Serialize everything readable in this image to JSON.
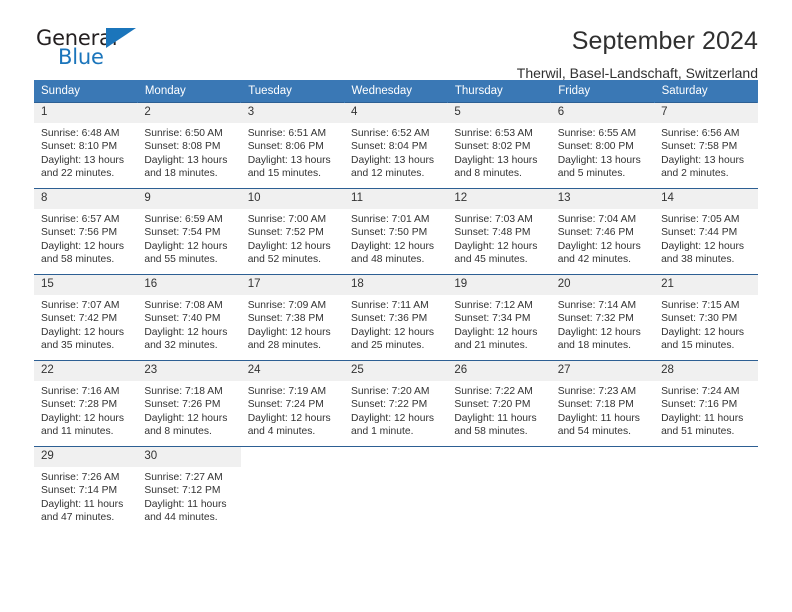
{
  "brand": {
    "name_top": "General",
    "name_bottom": "Blue",
    "triangle_color": "#1b75bb"
  },
  "header": {
    "title": "September 2024",
    "subtitle": "Therwil, Basel-Landschaft, Switzerland",
    "accent_color": "#3a78b5"
  },
  "calendar": {
    "weekday_headers": [
      "Sunday",
      "Monday",
      "Tuesday",
      "Wednesday",
      "Thursday",
      "Friday",
      "Saturday"
    ],
    "weeks": [
      [
        {
          "day": "1",
          "sunrise": "Sunrise: 6:48 AM",
          "sunset": "Sunset: 8:10 PM",
          "daylight": "Daylight: 13 hours and 22 minutes."
        },
        {
          "day": "2",
          "sunrise": "Sunrise: 6:50 AM",
          "sunset": "Sunset: 8:08 PM",
          "daylight": "Daylight: 13 hours and 18 minutes."
        },
        {
          "day": "3",
          "sunrise": "Sunrise: 6:51 AM",
          "sunset": "Sunset: 8:06 PM",
          "daylight": "Daylight: 13 hours and 15 minutes."
        },
        {
          "day": "4",
          "sunrise": "Sunrise: 6:52 AM",
          "sunset": "Sunset: 8:04 PM",
          "daylight": "Daylight: 13 hours and 12 minutes."
        },
        {
          "day": "5",
          "sunrise": "Sunrise: 6:53 AM",
          "sunset": "Sunset: 8:02 PM",
          "daylight": "Daylight: 13 hours and 8 minutes."
        },
        {
          "day": "6",
          "sunrise": "Sunrise: 6:55 AM",
          "sunset": "Sunset: 8:00 PM",
          "daylight": "Daylight: 13 hours and 5 minutes."
        },
        {
          "day": "7",
          "sunrise": "Sunrise: 6:56 AM",
          "sunset": "Sunset: 7:58 PM",
          "daylight": "Daylight: 13 hours and 2 minutes."
        }
      ],
      [
        {
          "day": "8",
          "sunrise": "Sunrise: 6:57 AM",
          "sunset": "Sunset: 7:56 PM",
          "daylight": "Daylight: 12 hours and 58 minutes."
        },
        {
          "day": "9",
          "sunrise": "Sunrise: 6:59 AM",
          "sunset": "Sunset: 7:54 PM",
          "daylight": "Daylight: 12 hours and 55 minutes."
        },
        {
          "day": "10",
          "sunrise": "Sunrise: 7:00 AM",
          "sunset": "Sunset: 7:52 PM",
          "daylight": "Daylight: 12 hours and 52 minutes."
        },
        {
          "day": "11",
          "sunrise": "Sunrise: 7:01 AM",
          "sunset": "Sunset: 7:50 PM",
          "daylight": "Daylight: 12 hours and 48 minutes."
        },
        {
          "day": "12",
          "sunrise": "Sunrise: 7:03 AM",
          "sunset": "Sunset: 7:48 PM",
          "daylight": "Daylight: 12 hours and 45 minutes."
        },
        {
          "day": "13",
          "sunrise": "Sunrise: 7:04 AM",
          "sunset": "Sunset: 7:46 PM",
          "daylight": "Daylight: 12 hours and 42 minutes."
        },
        {
          "day": "14",
          "sunrise": "Sunrise: 7:05 AM",
          "sunset": "Sunset: 7:44 PM",
          "daylight": "Daylight: 12 hours and 38 minutes."
        }
      ],
      [
        {
          "day": "15",
          "sunrise": "Sunrise: 7:07 AM",
          "sunset": "Sunset: 7:42 PM",
          "daylight": "Daylight: 12 hours and 35 minutes."
        },
        {
          "day": "16",
          "sunrise": "Sunrise: 7:08 AM",
          "sunset": "Sunset: 7:40 PM",
          "daylight": "Daylight: 12 hours and 32 minutes."
        },
        {
          "day": "17",
          "sunrise": "Sunrise: 7:09 AM",
          "sunset": "Sunset: 7:38 PM",
          "daylight": "Daylight: 12 hours and 28 minutes."
        },
        {
          "day": "18",
          "sunrise": "Sunrise: 7:11 AM",
          "sunset": "Sunset: 7:36 PM",
          "daylight": "Daylight: 12 hours and 25 minutes."
        },
        {
          "day": "19",
          "sunrise": "Sunrise: 7:12 AM",
          "sunset": "Sunset: 7:34 PM",
          "daylight": "Daylight: 12 hours and 21 minutes."
        },
        {
          "day": "20",
          "sunrise": "Sunrise: 7:14 AM",
          "sunset": "Sunset: 7:32 PM",
          "daylight": "Daylight: 12 hours and 18 minutes."
        },
        {
          "day": "21",
          "sunrise": "Sunrise: 7:15 AM",
          "sunset": "Sunset: 7:30 PM",
          "daylight": "Daylight: 12 hours and 15 minutes."
        }
      ],
      [
        {
          "day": "22",
          "sunrise": "Sunrise: 7:16 AM",
          "sunset": "Sunset: 7:28 PM",
          "daylight": "Daylight: 12 hours and 11 minutes."
        },
        {
          "day": "23",
          "sunrise": "Sunrise: 7:18 AM",
          "sunset": "Sunset: 7:26 PM",
          "daylight": "Daylight: 12 hours and 8 minutes."
        },
        {
          "day": "24",
          "sunrise": "Sunrise: 7:19 AM",
          "sunset": "Sunset: 7:24 PM",
          "daylight": "Daylight: 12 hours and 4 minutes."
        },
        {
          "day": "25",
          "sunrise": "Sunrise: 7:20 AM",
          "sunset": "Sunset: 7:22 PM",
          "daylight": "Daylight: 12 hours and 1 minute."
        },
        {
          "day": "26",
          "sunrise": "Sunrise: 7:22 AM",
          "sunset": "Sunset: 7:20 PM",
          "daylight": "Daylight: 11 hours and 58 minutes."
        },
        {
          "day": "27",
          "sunrise": "Sunrise: 7:23 AM",
          "sunset": "Sunset: 7:18 PM",
          "daylight": "Daylight: 11 hours and 54 minutes."
        },
        {
          "day": "28",
          "sunrise": "Sunrise: 7:24 AM",
          "sunset": "Sunset: 7:16 PM",
          "daylight": "Daylight: 11 hours and 51 minutes."
        }
      ],
      [
        {
          "day": "29",
          "sunrise": "Sunrise: 7:26 AM",
          "sunset": "Sunset: 7:14 PM",
          "daylight": "Daylight: 11 hours and 47 minutes."
        },
        {
          "day": "30",
          "sunrise": "Sunrise: 7:27 AM",
          "sunset": "Sunset: 7:12 PM",
          "daylight": "Daylight: 11 hours and 44 minutes."
        },
        {
          "day": "",
          "sunrise": "",
          "sunset": "",
          "daylight": ""
        },
        {
          "day": "",
          "sunrise": "",
          "sunset": "",
          "daylight": ""
        },
        {
          "day": "",
          "sunrise": "",
          "sunset": "",
          "daylight": ""
        },
        {
          "day": "",
          "sunrise": "",
          "sunset": "",
          "daylight": ""
        },
        {
          "day": "",
          "sunrise": "",
          "sunset": "",
          "daylight": ""
        }
      ]
    ]
  }
}
